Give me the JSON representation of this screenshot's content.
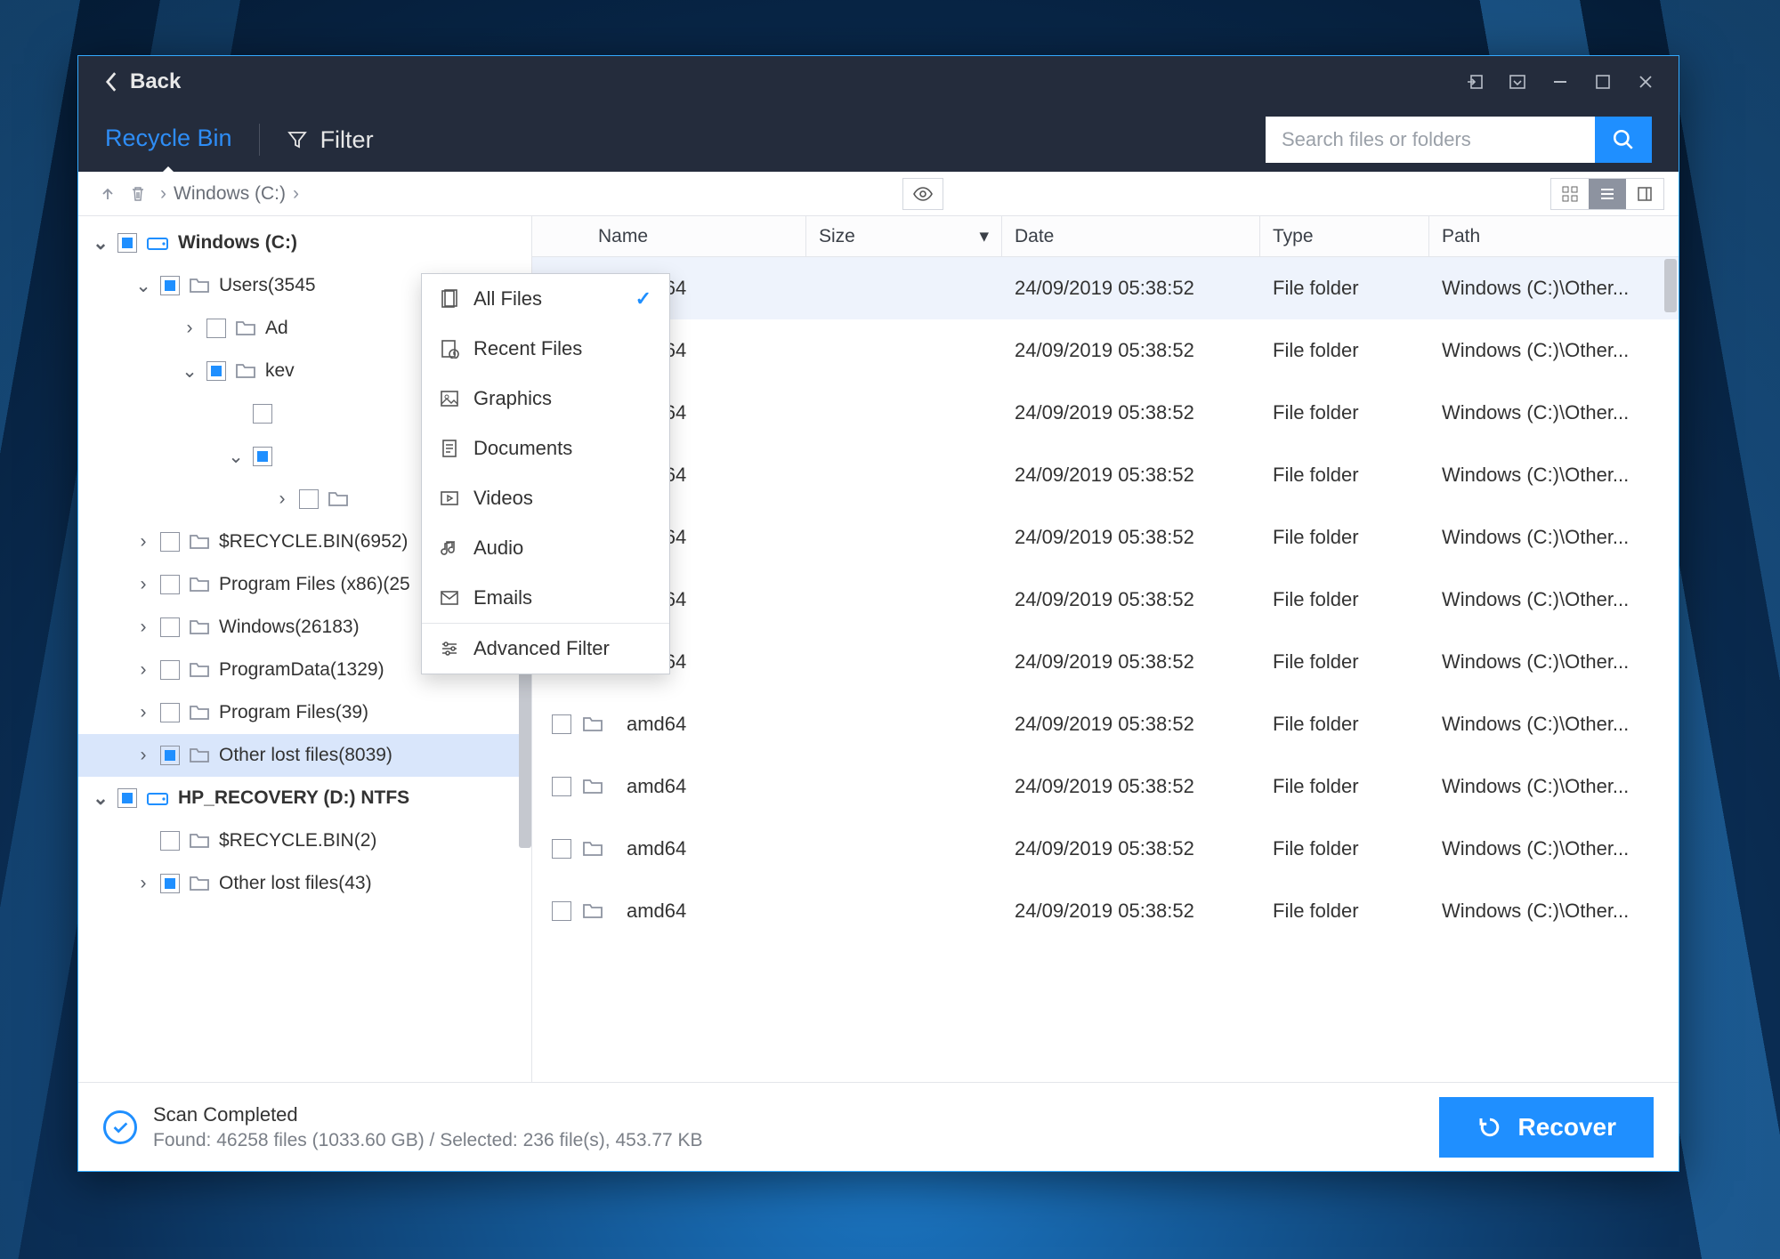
{
  "titlebar": {
    "back": "Back"
  },
  "toolbar": {
    "tab_active": "Recycle Bin",
    "filter_label": "Filter",
    "search_placeholder": "Search files or folders"
  },
  "breadcrumb": {
    "part1": "Windows (C:)"
  },
  "filter_menu": {
    "items": [
      {
        "label": "All Files",
        "checked": true
      },
      {
        "label": "Recent Files"
      },
      {
        "label": "Graphics"
      },
      {
        "label": "Documents"
      },
      {
        "label": "Videos"
      },
      {
        "label": "Audio"
      },
      {
        "label": "Emails"
      }
    ],
    "advanced": "Advanced Filter"
  },
  "tree": [
    {
      "pad": 0,
      "tgl": "v",
      "cb": "semi",
      "drive": true,
      "bold": true,
      "label": "Windows (C:) "
    },
    {
      "pad": 1,
      "tgl": "v",
      "cb": "semi",
      "label": "Users(3545"
    },
    {
      "pad": 2,
      "tgl": ">",
      "cb": "",
      "label": "Ad"
    },
    {
      "pad": 2,
      "tgl": "v",
      "cb": "semi",
      "label": "kev"
    },
    {
      "pad": 3,
      "tgl": "",
      "cb": "",
      "label": "",
      "noicon": true
    },
    {
      "pad": 3,
      "tgl": "v",
      "cb": "semi",
      "label": "",
      "noicon": true
    },
    {
      "pad": 4,
      "tgl": ">",
      "cb": "",
      "label": ""
    },
    {
      "pad": 1,
      "tgl": ">",
      "cb": "",
      "label": "$RECYCLE.BIN(6952)"
    },
    {
      "pad": 1,
      "tgl": ">",
      "cb": "",
      "label": "Program Files (x86)(25"
    },
    {
      "pad": 1,
      "tgl": ">",
      "cb": "",
      "label": "Windows(26183)"
    },
    {
      "pad": 1,
      "tgl": ">",
      "cb": "",
      "label": "ProgramData(1329)"
    },
    {
      "pad": 1,
      "tgl": ">",
      "cb": "",
      "label": "Program Files(39)"
    },
    {
      "pad": 1,
      "tgl": ">",
      "cb": "semi",
      "sel": true,
      "label": "Other lost files(8039)"
    },
    {
      "pad": 0,
      "tgl": "v",
      "cb": "semi",
      "drive": true,
      "bold": true,
      "label": "HP_RECOVERY (D:) NTFS"
    },
    {
      "pad": 1,
      "tgl": "",
      "cb": "",
      "label": "$RECYCLE.BIN(2)"
    },
    {
      "pad": 1,
      "tgl": ">",
      "cb": "semi",
      "label": "Other lost files(43)"
    }
  ],
  "columns": {
    "name": "Name",
    "size": "Size",
    "date": "Date",
    "type": "Type",
    "path": "Path"
  },
  "rows": [
    {
      "name": "amd64",
      "size": "",
      "date": "24/09/2019 05:38:52",
      "type": "File folder",
      "path": "Windows (C:)\\Other...",
      "hover": true
    },
    {
      "name": "amd64",
      "size": "",
      "date": "24/09/2019 05:38:52",
      "type": "File folder",
      "path": "Windows (C:)\\Other..."
    },
    {
      "name": "amd64",
      "size": "",
      "date": "24/09/2019 05:38:52",
      "type": "File folder",
      "path": "Windows (C:)\\Other..."
    },
    {
      "name": "amd64",
      "size": "",
      "date": "24/09/2019 05:38:52",
      "type": "File folder",
      "path": "Windows (C:)\\Other..."
    },
    {
      "name": "amd64",
      "size": "",
      "date": "24/09/2019 05:38:52",
      "type": "File folder",
      "path": "Windows (C:)\\Other..."
    },
    {
      "name": "amd64",
      "size": "",
      "date": "24/09/2019 05:38:52",
      "type": "File folder",
      "path": "Windows (C:)\\Other..."
    },
    {
      "name": "amd64",
      "size": "",
      "date": "24/09/2019 05:38:52",
      "type": "File folder",
      "path": "Windows (C:)\\Other..."
    },
    {
      "name": "amd64",
      "size": "",
      "date": "24/09/2019 05:38:52",
      "type": "File folder",
      "path": "Windows (C:)\\Other..."
    },
    {
      "name": "amd64",
      "size": "",
      "date": "24/09/2019 05:38:52",
      "type": "File folder",
      "path": "Windows (C:)\\Other..."
    },
    {
      "name": "amd64",
      "size": "",
      "date": "24/09/2019 05:38:52",
      "type": "File folder",
      "path": "Windows (C:)\\Other..."
    },
    {
      "name": "amd64",
      "size": "",
      "date": "24/09/2019 05:38:52",
      "type": "File folder",
      "path": "Windows (C:)\\Other..."
    }
  ],
  "footer": {
    "title": "Scan Completed",
    "detail": "Found: 46258 files (1033.60 GB) / Selected: 236 file(s), 453.77 KB",
    "recover": "Recover"
  }
}
